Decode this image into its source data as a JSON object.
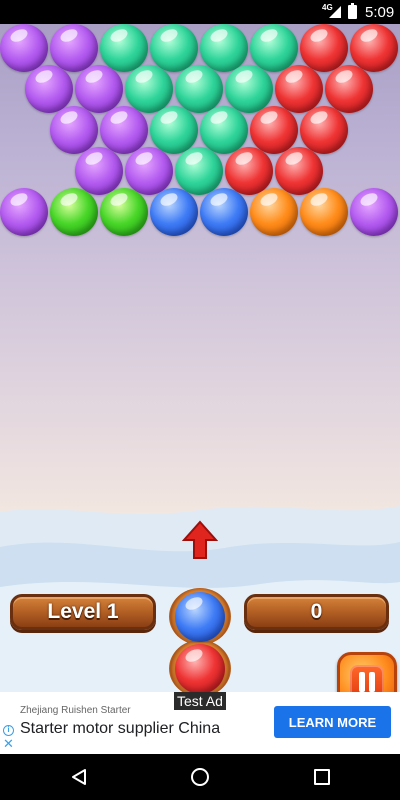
{
  "status_bar": {
    "network": "4G",
    "time": "5:09"
  },
  "game": {
    "level_label": "Level 1",
    "score": "0",
    "bubble_rows": [
      [
        "purple",
        "purple",
        "teal",
        "teal",
        "teal",
        "teal",
        "red",
        "red"
      ],
      [
        "purple",
        "purple",
        "teal",
        "teal",
        "teal",
        "red",
        "red"
      ],
      [
        "purple",
        "purple",
        "teal",
        "teal",
        "red",
        "red"
      ],
      [
        "purple",
        "purple",
        "teal",
        "red",
        "red"
      ],
      [
        "purple",
        "green",
        "green",
        "blue",
        "blue",
        "orange",
        "orange",
        "purple"
      ]
    ],
    "current_bubble": "blue",
    "next_bubble": "red"
  },
  "ad": {
    "test_label": "Test Ad",
    "sponsor": "Zhejiang Ruishen Starter",
    "title": "Starter motor supplier China",
    "cta": "LEARN MORE"
  }
}
